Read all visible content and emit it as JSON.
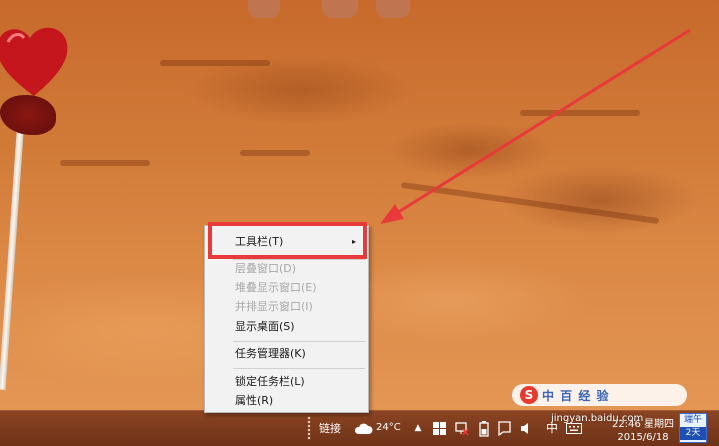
{
  "context_menu": {
    "items": [
      {
        "label": "工具栏(T)",
        "enabled": true,
        "has_submenu": true
      },
      {
        "label": "层叠窗口(D)",
        "enabled": false
      },
      {
        "label": "堆叠显示窗口(E)",
        "enabled": false
      },
      {
        "label": "并排显示窗口(I)",
        "enabled": false
      },
      {
        "label": "显示桌面(S)",
        "enabled": true
      },
      {
        "label": "任务管理器(K)",
        "enabled": true
      },
      {
        "label": "锁定任务栏(L)",
        "enabled": true
      },
      {
        "label": "属性(R)",
        "enabled": true
      }
    ],
    "submenu_arrow": "▸"
  },
  "taskbar": {
    "links_label": "链接",
    "weather": {
      "temperature": "24°C",
      "icon": "cloud-icon"
    },
    "tray_icons": [
      "chevron-up-icon",
      "windows-flag-icon",
      "network-off-icon",
      "battery-icon",
      "action-center-icon",
      "volume-icon",
      "input-method-icon",
      "keyboard-icon"
    ],
    "input_method_label": "中",
    "clock": {
      "time": "22:46 星期四",
      "date": "2015/6/18"
    },
    "calendar_badge": {
      "top": "端午",
      "bottom": "2天"
    }
  },
  "watermark": {
    "brand": "中 百 经 验",
    "url": "jingyan.baidu.com"
  },
  "annotation": {
    "color": "#e83a3a"
  },
  "colors": {
    "menu_bg": "#f2f2f2",
    "taskbar": "#7a3a1c",
    "disabled_text": "#a8a8a8"
  }
}
